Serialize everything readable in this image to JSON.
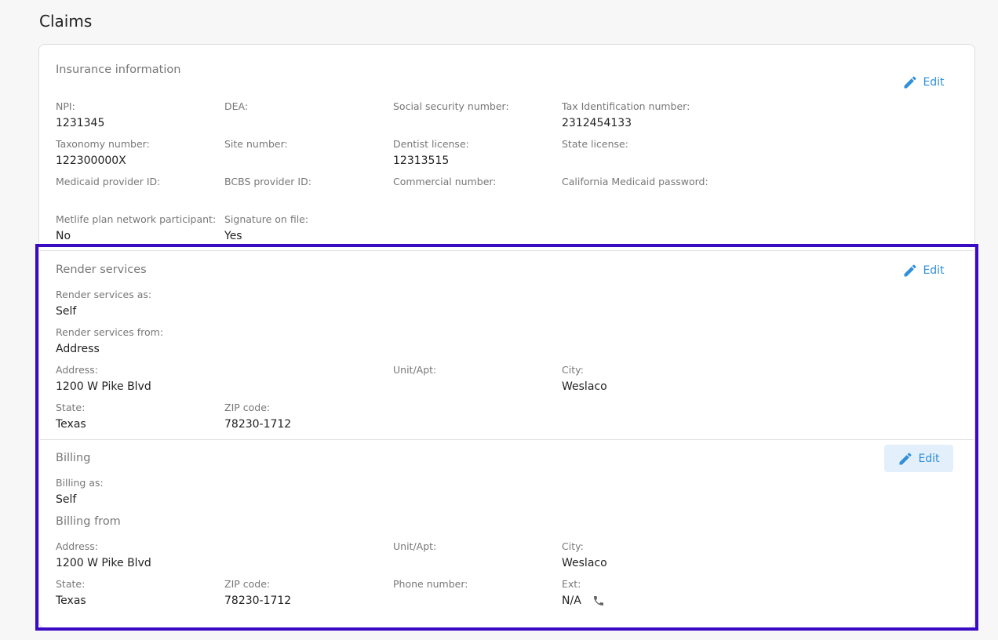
{
  "page": {
    "title": "Claims"
  },
  "insurance": {
    "title": "Insurance information",
    "edit_label": "Edit",
    "fields": {
      "npi": {
        "label": "NPI:",
        "value": "1231345"
      },
      "dea": {
        "label": "DEA:",
        "value": ""
      },
      "ssn": {
        "label": "Social security number:",
        "value": ""
      },
      "tin": {
        "label": "Tax Identification number:",
        "value": "2312454133"
      },
      "taxonomy": {
        "label": "Taxonomy number:",
        "value": "122300000X"
      },
      "site": {
        "label": "Site number:",
        "value": ""
      },
      "dentist_license": {
        "label": "Dentist license:",
        "value": "12313515"
      },
      "state_license": {
        "label": "State license:",
        "value": ""
      },
      "medicaid": {
        "label": "Medicaid provider ID:",
        "value": ""
      },
      "bcbs": {
        "label": "BCBS provider ID:",
        "value": ""
      },
      "commercial": {
        "label": "Commercial number:",
        "value": ""
      },
      "ca_medicaid_pw": {
        "label": "California Medicaid password:",
        "value": ""
      },
      "metlife": {
        "label": "Metlife plan network participant:",
        "value": "No"
      },
      "signature": {
        "label": "Signature on file:",
        "value": "Yes"
      }
    }
  },
  "render": {
    "title": "Render services",
    "edit_label": "Edit",
    "fields": {
      "as": {
        "label": "Render services as:",
        "value": "Self"
      },
      "from": {
        "label": "Render services from:",
        "value": "Address"
      },
      "address": {
        "label": "Address:",
        "value": "1200 W Pike Blvd"
      },
      "unit": {
        "label": "Unit/Apt:",
        "value": ""
      },
      "city": {
        "label": "City:",
        "value": "Weslaco"
      },
      "state": {
        "label": "State:",
        "value": "Texas"
      },
      "zip": {
        "label": "ZIP code:",
        "value": "78230-1712"
      }
    }
  },
  "billing": {
    "title": "Billing",
    "edit_label": "Edit",
    "from_title": "Billing from",
    "fields": {
      "as": {
        "label": "Billing as:",
        "value": "Self"
      },
      "address": {
        "label": "Address:",
        "value": "1200 W Pike Blvd"
      },
      "unit": {
        "label": "Unit/Apt:",
        "value": ""
      },
      "city": {
        "label": "City:",
        "value": "Weslaco"
      },
      "state": {
        "label": "State:",
        "value": "Texas"
      },
      "zip": {
        "label": "ZIP code:",
        "value": "78230-1712"
      },
      "phone": {
        "label": "Phone number:",
        "value": ""
      },
      "ext": {
        "label": "Ext:",
        "value": "N/A"
      }
    }
  },
  "colors": {
    "accent": "#2f8fd8",
    "highlight": "#3b0bc4"
  },
  "icons": {
    "edit": "pencil-icon",
    "phone": "phone-icon"
  }
}
